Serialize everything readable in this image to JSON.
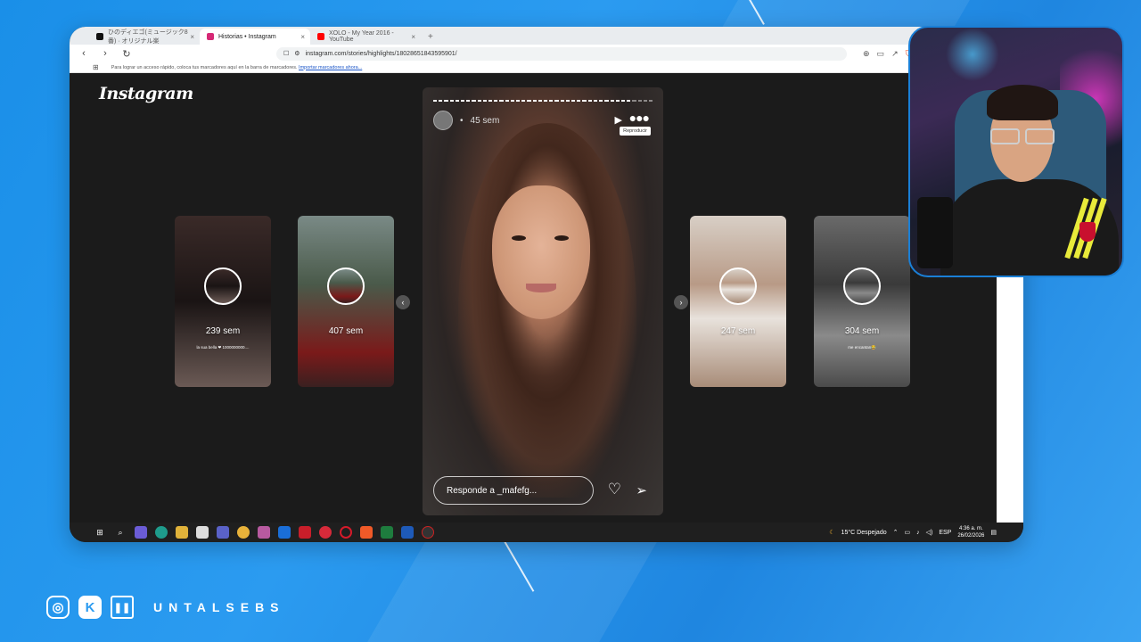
{
  "browser": {
    "tabs": [
      {
        "title": "ひのディエゴ(ミュージック8番) · オリジナル楽",
        "favicon": "tiktok-icon",
        "color": "#111111"
      },
      {
        "title": "Historias • Instagram",
        "favicon": "instagram-icon",
        "color": "#d62976",
        "active": true
      },
      {
        "title": "XOLO - My Year 2016 - YouTube",
        "favicon": "youtube-icon",
        "color": "#ff0000"
      }
    ],
    "new_tab": "+",
    "url": "instagram.com/stories/highlights/18028651843595901/",
    "bookmarks_hint": "Para lograr un acceso rápido, coloca tus marcadores aquí en la barra de marcadores.",
    "bookmarks_link": "Importar marcadores ahora..."
  },
  "instagram": {
    "logo": "Instagram",
    "thumbnails": [
      {
        "label": "239 sem",
        "caption": "la sua bella ❤ 1000000000....",
        "bg": "linear-gradient(180deg,#3a2a28,#1a1414 50%,#6b5a55)"
      },
      {
        "label": "407 sem",
        "caption": "",
        "bg": "linear-gradient(180deg,#7a8a86,#4a5a4a 40%,#7a1a1a 80%,#3a2020)"
      },
      {
        "label": "247 sem",
        "caption": "",
        "bg": "linear-gradient(180deg,#d8cfc6,#b89a86 40%,#e8e2dc 60%,#a88c78)"
      },
      {
        "label": "304 sem",
        "caption": "me encantan😂",
        "bg": "linear-gradient(180deg,#6a6a6a,#3a3a3a 40%,#8a8a8a 70%,#4a4a4a)"
      }
    ],
    "story": {
      "time_ago": "45 sem",
      "tooltip": "Reproducir",
      "reply_placeholder": "Responde a _mafefg...",
      "progress_segments": 40,
      "progress_done": 36
    }
  },
  "taskbar": {
    "weather": "15°C  Despejado",
    "language": "ESP",
    "time": "4:36 a. m.",
    "date": "26/02/2026"
  },
  "overlay": {
    "handle": "UNTALSEBS"
  }
}
